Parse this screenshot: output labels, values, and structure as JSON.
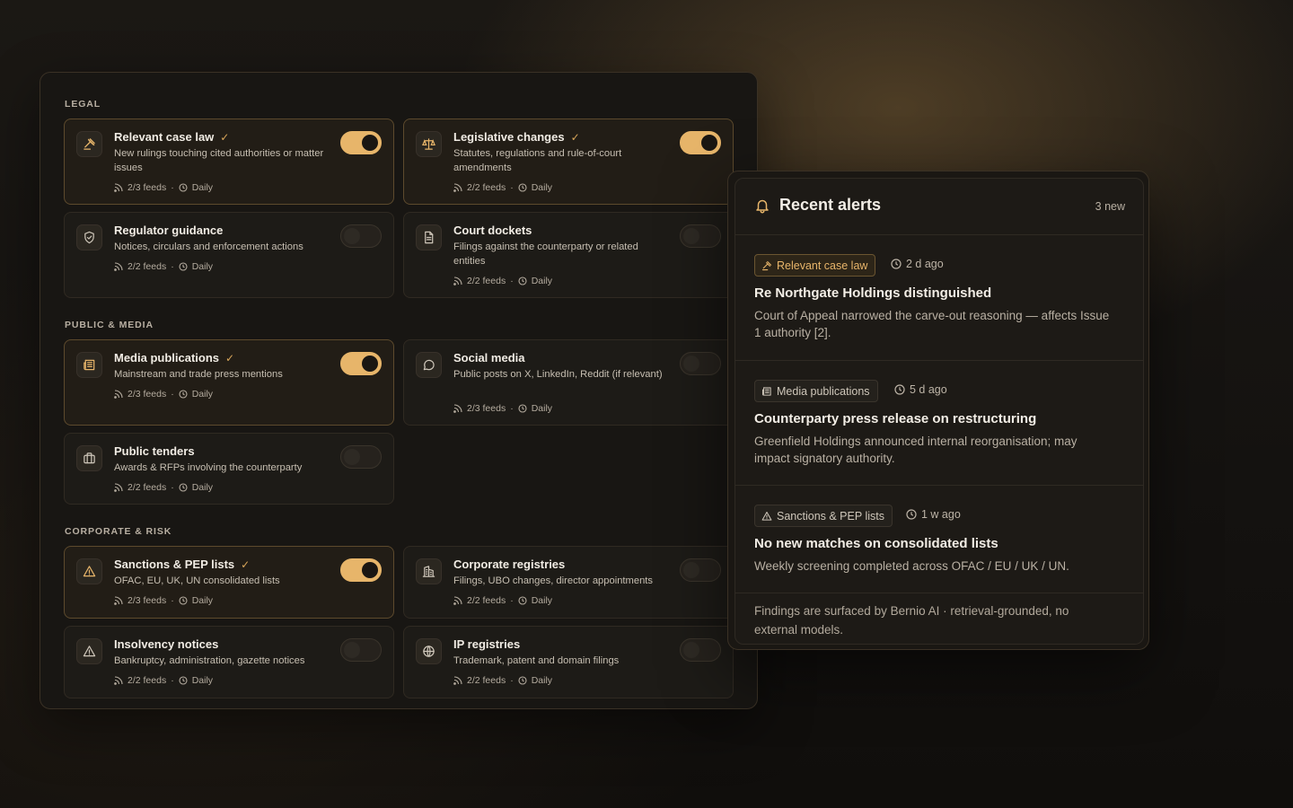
{
  "colors": {
    "accent": "#e7b56a",
    "accent_dark": "#d9a65a",
    "panel": "#181613"
  },
  "sections": [
    {
      "title": "LEGAL"
    },
    {
      "title": "PUBLIC & MEDIA"
    },
    {
      "title": "CORPORATE & RISK"
    }
  ],
  "cards": [
    {
      "icon": "gavel-icon",
      "title": "Relevant case law",
      "enabled": true,
      "checked": true,
      "desc": "New rulings touching cited authorities or matter issues",
      "feeds": "2/3 feeds",
      "frequency": "Daily"
    },
    {
      "icon": "scale-icon",
      "title": "Legislative changes",
      "enabled": true,
      "checked": true,
      "desc": "Statutes, regulations and rule-of-court amendments",
      "feeds": "2/2 feeds",
      "frequency": "Daily"
    },
    {
      "icon": "shield-icon",
      "title": "Regulator guidance",
      "enabled": false,
      "checked": false,
      "desc": "Notices, circulars and enforcement actions",
      "feeds": "2/2 feeds",
      "frequency": "Daily"
    },
    {
      "icon": "document-icon",
      "title": "Court dockets",
      "enabled": false,
      "checked": false,
      "desc": "Filings against the counterparty or related entities",
      "feeds": "2/2 feeds",
      "frequency": "Daily"
    },
    {
      "icon": "newspaper-icon",
      "title": "Media publications",
      "enabled": true,
      "checked": true,
      "desc": "Mainstream and trade press mentions",
      "feeds": "2/3 feeds",
      "frequency": "Daily"
    },
    {
      "icon": "chat-bubble-icon",
      "title": "Social media",
      "enabled": false,
      "checked": false,
      "desc": "Public posts on X, LinkedIn, Reddit (if relevant)",
      "feeds": "2/3 feeds",
      "frequency": "Daily"
    },
    {
      "icon": "briefcase-icon",
      "title": "Public tenders",
      "enabled": false,
      "checked": false,
      "desc": "Awards & RFPs involving the counterparty",
      "feeds": "2/2 feeds",
      "frequency": "Daily"
    },
    {
      "icon": "warning-icon",
      "title": "Sanctions & PEP lists",
      "enabled": true,
      "checked": true,
      "desc": "OFAC, EU, UK, UN consolidated lists",
      "feeds": "2/3 feeds",
      "frequency": "Daily"
    },
    {
      "icon": "building-icon",
      "title": "Corporate registries",
      "enabled": false,
      "checked": false,
      "desc": "Filings, UBO changes, director appointments",
      "feeds": "2/2 feeds",
      "frequency": "Daily"
    },
    {
      "icon": "warning-icon",
      "title": "Insolvency notices",
      "enabled": false,
      "checked": false,
      "desc": "Bankruptcy, administration, gazette notices",
      "feeds": "2/2 feeds",
      "frequency": "Daily"
    },
    {
      "icon": "globe-icon",
      "title": "IP registries",
      "enabled": false,
      "checked": false,
      "desc": "Trademark, patent and domain filings",
      "feeds": "2/2 feeds",
      "frequency": "Daily"
    }
  ],
  "alerts_panel": {
    "title": "Recent alerts",
    "count": "3 new",
    "items": [
      {
        "tag": "Relevant case law",
        "tag_icon": "gavel-icon",
        "highlight": true,
        "ago": "2 d ago",
        "title": "Re Northgate Holdings distinguished",
        "body": "Court of Appeal narrowed the carve-out reasoning — affects Issue 1 authority [2]."
      },
      {
        "tag": "Media publications",
        "tag_icon": "newspaper-icon",
        "highlight": false,
        "ago": "5 d ago",
        "title": "Counterparty press release on restructuring",
        "body": "Greenfield Holdings announced internal reorganisation; may impact signatory authority."
      },
      {
        "tag": "Sanctions & PEP lists",
        "tag_icon": "warning-icon",
        "highlight": false,
        "ago": "1 w ago",
        "title": "No new matches on consolidated lists",
        "body": "Weekly screening completed across OFAC / EU / UK / UN."
      }
    ],
    "footnote": "Findings are surfaced by Bernio AI · retrieval-grounded, no external models."
  }
}
